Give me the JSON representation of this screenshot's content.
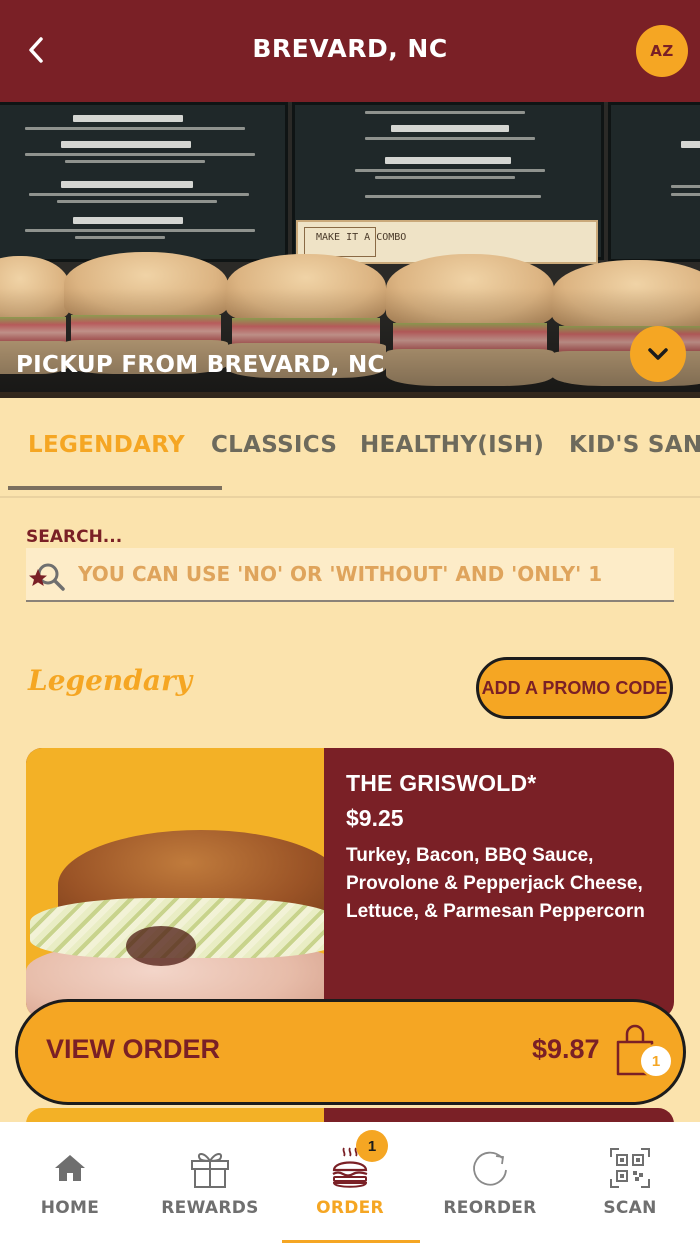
{
  "header": {
    "title": "BREVARD, NC",
    "avatar_initials": "AZ",
    "back_icon": "chevron-left-icon"
  },
  "hero": {
    "pickup_text": "PICKUP FROM BREVARD, NC",
    "toggle_icon": "chevron-down-icon",
    "combo_text": "MAKE IT A COMBO"
  },
  "tabs": [
    {
      "label": "LEGENDARY",
      "active": true
    },
    {
      "label": "CLASSICS",
      "active": false
    },
    {
      "label": "HEALTHY(ISH)",
      "active": false
    },
    {
      "label": "KID'S SANDWICHES",
      "active": false
    }
  ],
  "search": {
    "label": "SEARCH...",
    "placeholder": "YOU CAN USE 'NO' OR 'WITHOUT' AND 'ONLY' 1",
    "value": ""
  },
  "section": {
    "title": "Legendary",
    "promo_label": "ADD A PROMO CODE"
  },
  "products": [
    {
      "name": "THE GRISWOLD*",
      "price": "$9.25",
      "description": "Turkey, Bacon, BBQ Sauce, Provolone & Pepperjack Cheese, Lettuce, & Parmesan Peppercorn"
    }
  ],
  "order_bar": {
    "label": "VIEW ORDER",
    "total": "$9.87",
    "item_count": "1",
    "icon": "shopping-bag-icon"
  },
  "bottom_nav": {
    "items": [
      {
        "label": "HOME",
        "icon": "home-icon"
      },
      {
        "label": "REWARDS",
        "icon": "gift-icon"
      },
      {
        "label": "ORDER",
        "icon": "burger-icon",
        "badge": "1"
      },
      {
        "label": "REORDER",
        "icon": "refresh-icon"
      },
      {
        "label": "SCAN",
        "icon": "qr-code-icon"
      }
    ],
    "active_index": 2
  },
  "colors": {
    "brand_maroon": "#7a2026",
    "brand_gold": "#f5a623",
    "background": "#fbe3ad",
    "inactive_gray": "#6f6f6f"
  }
}
